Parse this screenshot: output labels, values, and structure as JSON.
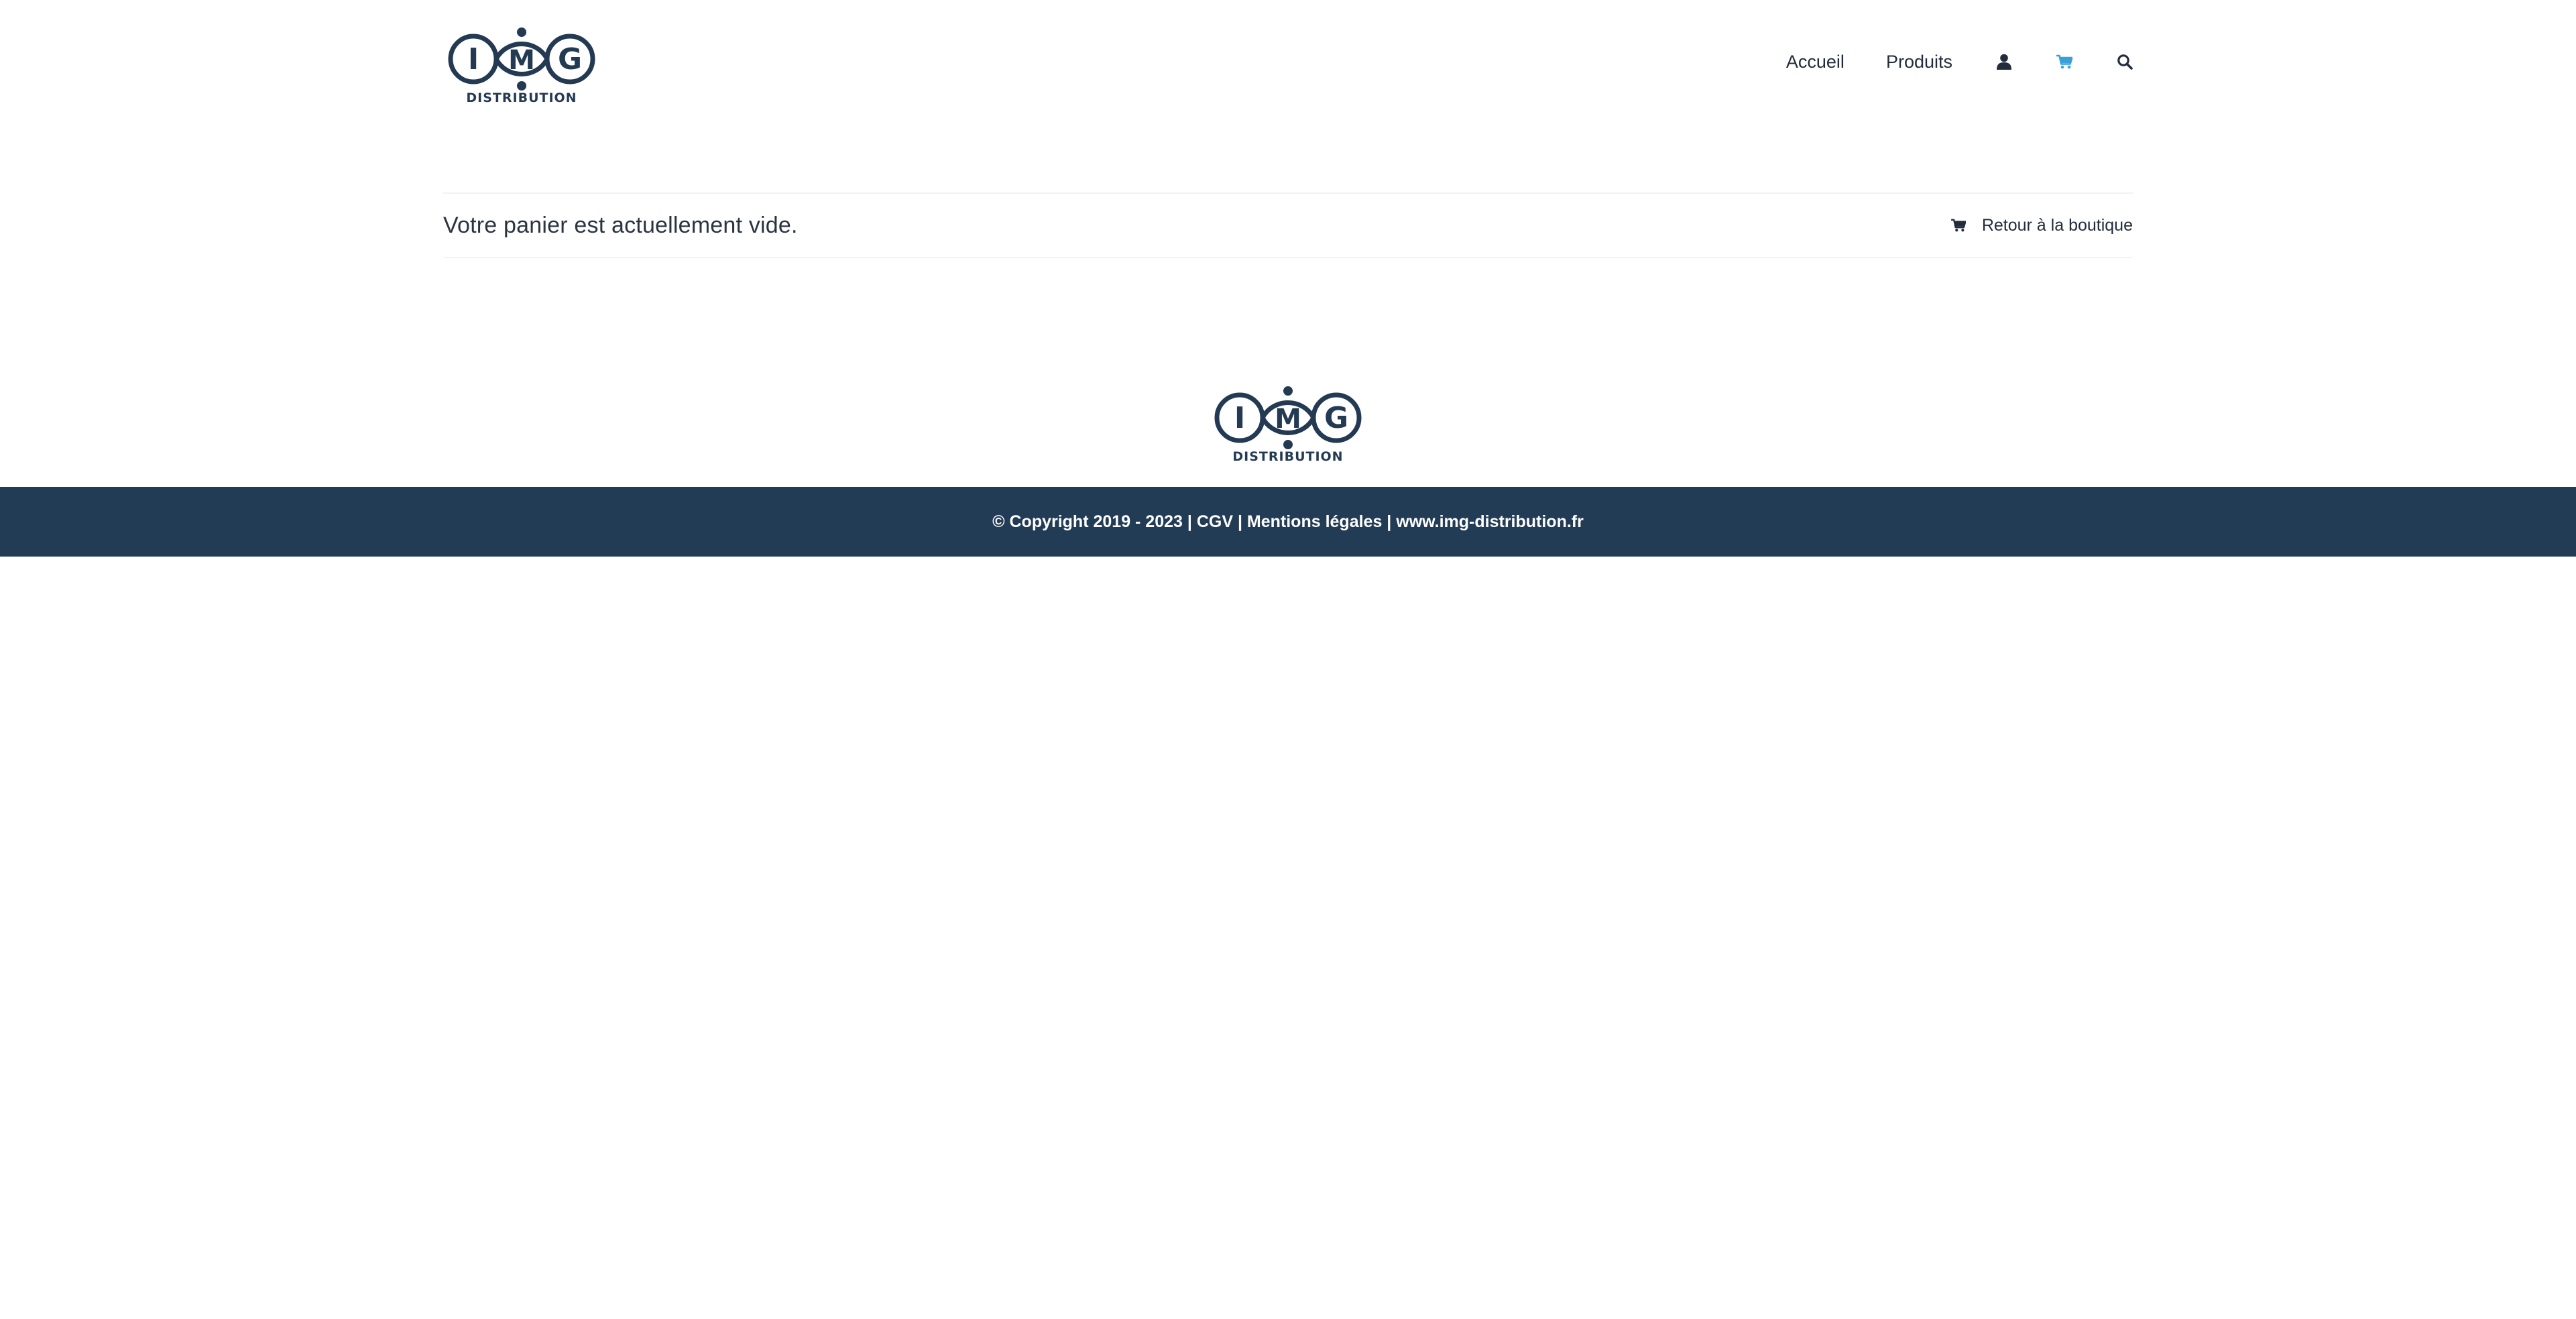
{
  "header": {
    "logo_word": "IMG",
    "logo_subtitle": "DISTRIBUTION",
    "nav": {
      "home_label": "Accueil",
      "products_label": "Produits",
      "account_icon": "user-icon",
      "cart_icon": "cart-icon",
      "search_icon": "search-icon"
    }
  },
  "main": {
    "empty_cart_message": "Votre panier est actuellement vide.",
    "return_link_label": "Retour à la boutique",
    "return_link_icon": "cart-icon"
  },
  "footer": {
    "logo_word": "IMG",
    "logo_subtitle": "DISTRIBUTION",
    "copyright": "© Copyright 2019 - 2023",
    "separator": " | ",
    "cgv_label": "CGV",
    "legal_label": "Mentions légales",
    "website_label": "www.img-distribution.fr"
  },
  "colors": {
    "brand_navy": "#233c55",
    "logo_navy": "#243a52",
    "active_cart": "#3aa0d8",
    "text_dark": "#222c3c",
    "divider": "#f2f3f5"
  }
}
